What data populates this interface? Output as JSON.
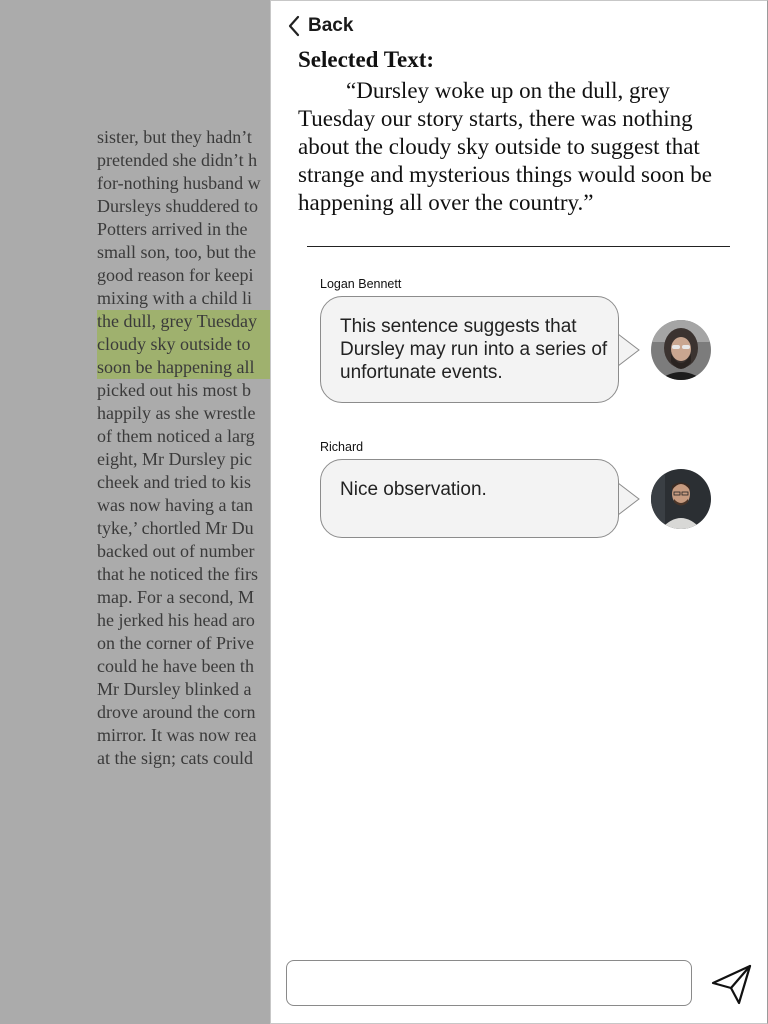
{
  "reader": {
    "lines": [
      {
        "text": "sister, but they hadn’t",
        "highlighted": false
      },
      {
        "text": "pretended she didn’t h",
        "highlighted": false
      },
      {
        "text": "for-nothing husband w",
        "highlighted": false
      },
      {
        "text": "Dursleys shuddered to",
        "highlighted": false
      },
      {
        "text": "Potters arrived in the",
        "highlighted": false
      },
      {
        "text": "small son, too, but the",
        "highlighted": false
      },
      {
        "text": "good reason for keepi",
        "highlighted": false
      },
      {
        "text": "mixing with a child li",
        "highlighted": false
      },
      {
        "text": "the dull, grey Tuesday",
        "highlighted": true
      },
      {
        "text": "cloudy sky outside to",
        "highlighted": true
      },
      {
        "text": "soon be happening all",
        "highlighted": true
      },
      {
        "text": "picked out his most b",
        "highlighted": false
      },
      {
        "text": "happily as she wrestle",
        "highlighted": false
      },
      {
        "text": "of them noticed a larg",
        "highlighted": false
      },
      {
        "text": "eight, Mr Dursley pic",
        "highlighted": false
      },
      {
        "text": "cheek and tried to kis",
        "highlighted": false
      },
      {
        "text": "was now having a tan",
        "highlighted": false
      },
      {
        "text": "tyke,’ chortled Mr Du",
        "highlighted": false
      },
      {
        "text": "backed out of number",
        "highlighted": false
      },
      {
        "text": "that he noticed the firs",
        "highlighted": false
      },
      {
        "text": "map. For a second, M",
        "highlighted": false
      },
      {
        "text": "he jerked his head aro",
        "highlighted": false
      },
      {
        "text": "on the corner of Prive",
        "highlighted": false
      },
      {
        "text": "could he have been th",
        "highlighted": false
      },
      {
        "text": "Mr Dursley blinked a",
        "highlighted": false
      },
      {
        "text": "drove around the corn",
        "highlighted": false
      },
      {
        "text": "mirror. It was now rea",
        "highlighted": false
      },
      {
        "text": "at the sign; cats could",
        "highlighted": false
      }
    ]
  },
  "panel": {
    "back_label": "Back",
    "selected_title": "Selected Text:",
    "selected_text": "“Dursley woke up on the dull, grey Tuesday our story starts, there was nothing about the cloudy sky outside to suggest that strange and mysterious things would soon be happening all over the country.”",
    "comments": [
      {
        "author": "Logan Bennett",
        "text": "This sentence suggests that Dursley may run into a series of unfortunate events."
      },
      {
        "author": "Richard",
        "text": "Nice observation."
      }
    ],
    "composer_value": "",
    "composer_placeholder": ""
  },
  "icons": {
    "back": "chevron-left-icon",
    "send": "send-icon"
  },
  "colors": {
    "highlight": "#9fb16e",
    "overlay": "#ababab",
    "bubble_bg": "#f3f3f3"
  }
}
